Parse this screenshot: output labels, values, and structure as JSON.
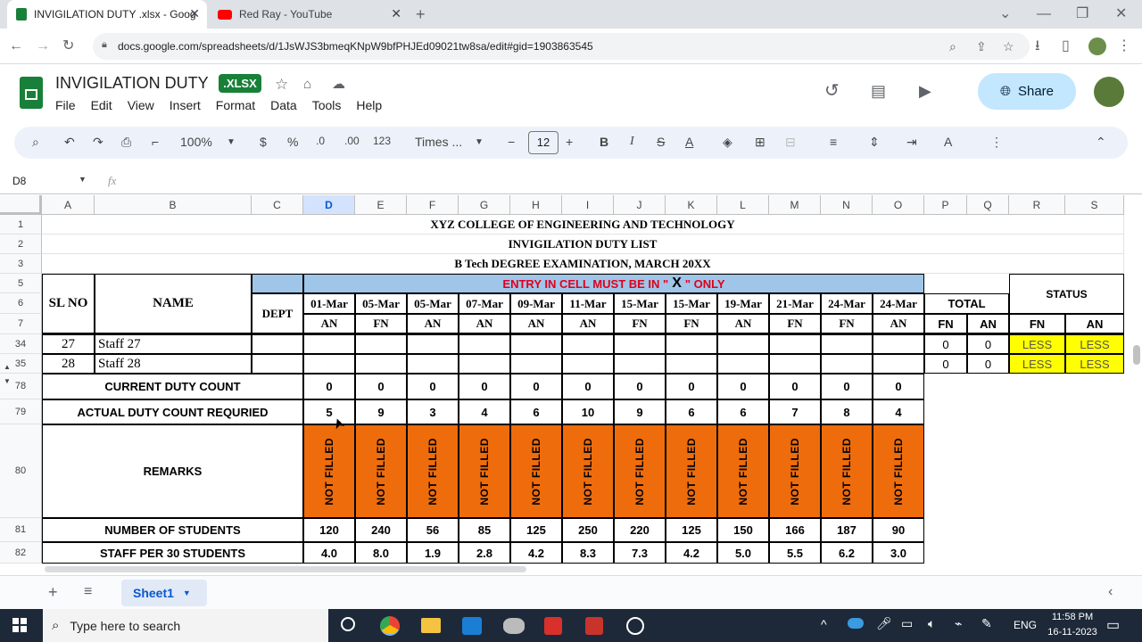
{
  "browser": {
    "tabs": [
      {
        "title": "INVIGILATION DUTY .xlsx - Goog",
        "active": true
      },
      {
        "title": "Red Ray - YouTube",
        "active": false
      }
    ],
    "url": "docs.google.com/spreadsheets/d/1JsWJS3bmeqKNpW9bfPHJEd09021tw8sa/edit#gid=1903863545"
  },
  "doc": {
    "title": "INVIGILATION DUTY",
    "badge": ".XLSX",
    "menu": [
      "File",
      "Edit",
      "View",
      "Insert",
      "Format",
      "Data",
      "Tools",
      "Help"
    ],
    "share_label": "Share"
  },
  "toolbar": {
    "zoom": "100%",
    "currency": "$",
    "percent": "%",
    "dec_less": ".0",
    "dec_more": ".00",
    "format_123": "123",
    "font": "Times ...",
    "font_size": "12"
  },
  "formula_bar": {
    "cell_ref": "D8",
    "fx": "fx"
  },
  "columns": [
    "A",
    "B",
    "C",
    "D",
    "E",
    "F",
    "G",
    "H",
    "I",
    "J",
    "K",
    "L",
    "M",
    "N",
    "O",
    "P",
    "Q",
    "R",
    "S"
  ],
  "rows_visible": [
    "1",
    "2",
    "3",
    "5",
    "6",
    "7",
    "34",
    "35",
    "78",
    "79",
    "80",
    "81",
    "82"
  ],
  "sheet": {
    "title1": "XYZ COLLEGE OF ENGINEERING AND TECHNOLOGY",
    "title2": "INVIGILATION DUTY LIST",
    "title3": "B Tech DEGREE EXAMINATION, MARCH 20XX",
    "entry_note_pre": "ENTRY IN CELL MUST BE IN \"",
    "entry_note_x": "X",
    "entry_note_post": "\" ONLY",
    "hdr_slno": "SL NO",
    "hdr_name": "NAME",
    "hdr_dept": "DEPT",
    "hdr_total": "TOTAL",
    "hdr_status": "STATUS",
    "dates": [
      "01-Mar",
      "05-Mar",
      "05-Mar",
      "07-Mar",
      "09-Mar",
      "11-Mar",
      "15-Mar",
      "15-Mar",
      "19-Mar",
      "21-Mar",
      "24-Mar",
      "24-Mar"
    ],
    "sessions": [
      "AN",
      "FN",
      "AN",
      "AN",
      "AN",
      "AN",
      "FN",
      "FN",
      "AN",
      "FN",
      "FN",
      "AN"
    ],
    "total_sessions": [
      "FN",
      "AN"
    ],
    "status_sessions": [
      "FN",
      "AN"
    ],
    "staff_rows": [
      {
        "sl": "27",
        "name": "Staff 27",
        "fn": "0",
        "an": "0",
        "status_fn": "LESS",
        "status_an": "LESS"
      },
      {
        "sl": "28",
        "name": "Staff 28",
        "fn": "0",
        "an": "0",
        "status_fn": "LESS",
        "status_an": "LESS"
      }
    ],
    "current_label": "CURRENT DUTY COUNT",
    "current_counts": [
      "0",
      "0",
      "0",
      "0",
      "0",
      "0",
      "0",
      "0",
      "0",
      "0",
      "0",
      "0"
    ],
    "actual_label": "ACTUAL DUTY COUNT REQURIED",
    "actual_counts": [
      "5",
      "9",
      "3",
      "4",
      "6",
      "10",
      "9",
      "6",
      "6",
      "7",
      "8",
      "4"
    ],
    "remarks_label": "REMARKS",
    "remarks": [
      "NOT FILLED",
      "NOT FILLED",
      "NOT FILLED",
      "NOT FILLED",
      "NOT FILLED",
      "NOT FILLED",
      "NOT FILLED",
      "NOT FILLED",
      "NOT FILLED",
      "NOT FILLED",
      "NOT FILLED",
      "NOT FILLED"
    ],
    "students_label": "NUMBER OF STUDENTS",
    "students": [
      "120",
      "240",
      "56",
      "85",
      "125",
      "250",
      "220",
      "125",
      "150",
      "166",
      "187",
      "90"
    ],
    "staff_label": "STAFF PER 30 STUDENTS",
    "staff_per": [
      "4.0",
      "8.0",
      "1.9",
      "2.8",
      "4.2",
      "8.3",
      "7.3",
      "4.2",
      "5.0",
      "5.5",
      "6.2",
      "3.0"
    ]
  },
  "sheet_tab": "Sheet1",
  "taskbar": {
    "search_placeholder": "Type here to search",
    "lang": "ENG",
    "time": "11:58 PM",
    "date": "16-11-2023"
  },
  "colors": {
    "orange": "#ee6c0b",
    "yellow": "#ffff00",
    "header_blue": "#9fc5e8",
    "entry_red": "#e0001b",
    "sheets_green": "#188038"
  }
}
